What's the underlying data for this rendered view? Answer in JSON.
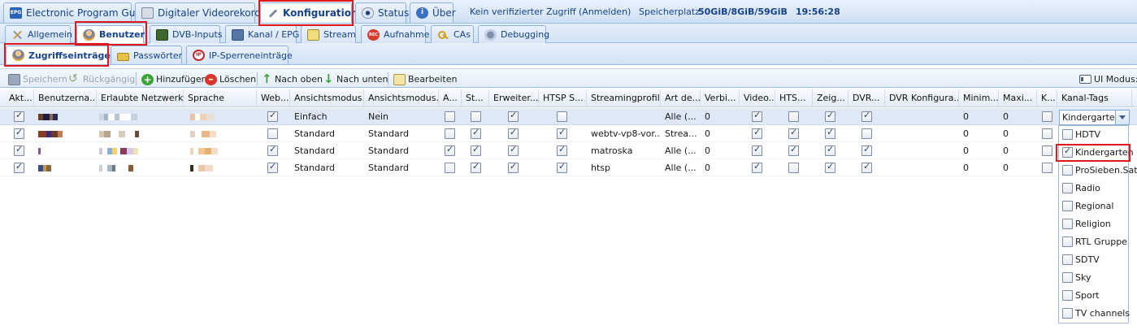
{
  "main_tabs": [
    {
      "label": "Electronic Program Guide",
      "icon": "epg-icon"
    },
    {
      "label": "Digitaler Videorekorder",
      "icon": "dvr-icon"
    },
    {
      "label": "Konfiguration",
      "icon": "wrench-icon",
      "active": true
    },
    {
      "label": "Status",
      "icon": "eye-icon"
    },
    {
      "label": "Über",
      "icon": "info-icon"
    }
  ],
  "status": {
    "access": "Kein verifizierter Zugriff",
    "login": "(Anmelden)",
    "storage_label": "Speicherplatz:",
    "storage_value": "50GiB/8GiB/59GiB",
    "time": "19:56:28"
  },
  "config_tabs": [
    {
      "label": "Allgemein",
      "icon": "tools-icon"
    },
    {
      "label": "Benutzer",
      "icon": "user-icon",
      "active": true
    },
    {
      "label": "DVB-Inputs",
      "icon": "dvb-icon"
    },
    {
      "label": "Kanal / EPG",
      "icon": "tv-icon"
    },
    {
      "label": "Stream",
      "icon": "stream-icon"
    },
    {
      "label": "Aufnahme",
      "icon": "rec-icon"
    },
    {
      "label": "CAs",
      "icon": "key-icon"
    },
    {
      "label": "Debugging",
      "icon": "bug-icon"
    }
  ],
  "user_tabs": [
    {
      "label": "Zugriffseinträge",
      "icon": "user-icon",
      "active": true
    },
    {
      "label": "Passwörter",
      "icon": "lock-icon"
    },
    {
      "label": "IP-Sperreneinträge",
      "icon": "block-icon"
    }
  ],
  "toolbar": {
    "save": "Speichern",
    "undo": "Rückgängig",
    "add": "Hinzufügen",
    "delete": "Löschen",
    "move_up": "Nach oben",
    "move_down": "Nach unten",
    "edit": "Bearbeiten",
    "ui_mode": "UI Modus:"
  },
  "columns": [
    "Akt...",
    "Benutzerna...",
    "Erlaubte Netzwerke",
    "Sprache",
    "Web...",
    "Ansichtsmodus...",
    "Ansichtsmodus...",
    "A...",
    "St...",
    "Erweiter...",
    "HTSP S...",
    "Streamingprofil",
    "Art de...",
    "Verbi...",
    "Video...",
    "HTS...",
    "Zeig...",
    "DVR...",
    "DVR Konfigura...",
    "Minim...",
    "Maxi...",
    "K...",
    "Kanal-Tags"
  ],
  "rows": [
    {
      "aktiv": true,
      "web": true,
      "ansicht1": "Einfach",
      "ansicht2": "Nein",
      "a": false,
      "st": false,
      "erw": true,
      "htsp": false,
      "profil": "",
      "art": "Alle (...",
      "verbi": "0",
      "video": true,
      "hts": false,
      "zeig": true,
      "dvr": true,
      "min": "0",
      "max": "0",
      "k": false,
      "selected": true
    },
    {
      "aktiv": true,
      "web": false,
      "ansicht1": "Standard",
      "ansicht2": "Standard",
      "a": false,
      "st": true,
      "erw": true,
      "htsp": true,
      "profil": "webtv-vp8-vor...",
      "art": "Strea...",
      "verbi": "0",
      "video": true,
      "hts": true,
      "zeig": true,
      "dvr": false,
      "min": "0",
      "max": "0",
      "k": false,
      "selected": false
    },
    {
      "aktiv": true,
      "web": true,
      "ansicht1": "Standard",
      "ansicht2": "Standard",
      "a": true,
      "st": true,
      "erw": true,
      "htsp": true,
      "profil": "matroska",
      "art": "Alle (...",
      "verbi": "0",
      "video": true,
      "hts": true,
      "zeig": true,
      "dvr": true,
      "min": "0",
      "max": "0",
      "k": false,
      "selected": false
    },
    {
      "aktiv": true,
      "web": true,
      "ansicht1": "Standard",
      "ansicht2": "Standard",
      "a": false,
      "st": true,
      "erw": true,
      "htsp": true,
      "profil": "htsp",
      "art": "Alle (...",
      "verbi": "0",
      "video": true,
      "hts": false,
      "zeig": true,
      "dvr": true,
      "min": "0",
      "max": "0",
      "k": false,
      "selected": false
    }
  ],
  "kanal_tags_combo": {
    "value": "Kindergarten"
  },
  "kanal_tags_options": [
    {
      "label": "HDTV",
      "checked": false
    },
    {
      "label": "Kindergarten",
      "checked": true
    },
    {
      "label": "ProSieben.Sat",
      "checked": false
    },
    {
      "label": "Radio",
      "checked": false
    },
    {
      "label": "Regional",
      "checked": false
    },
    {
      "label": "Religion",
      "checked": false
    },
    {
      "label": "RTL Gruppe",
      "checked": false
    },
    {
      "label": "SDTV",
      "checked": false
    },
    {
      "label": "Sky",
      "checked": false
    },
    {
      "label": "Sport",
      "checked": false
    },
    {
      "label": "TV channels",
      "checked": false
    }
  ],
  "colors": {
    "accent": "#15428b",
    "highlight": "#e0181b",
    "selection": "#dfe8f6"
  }
}
